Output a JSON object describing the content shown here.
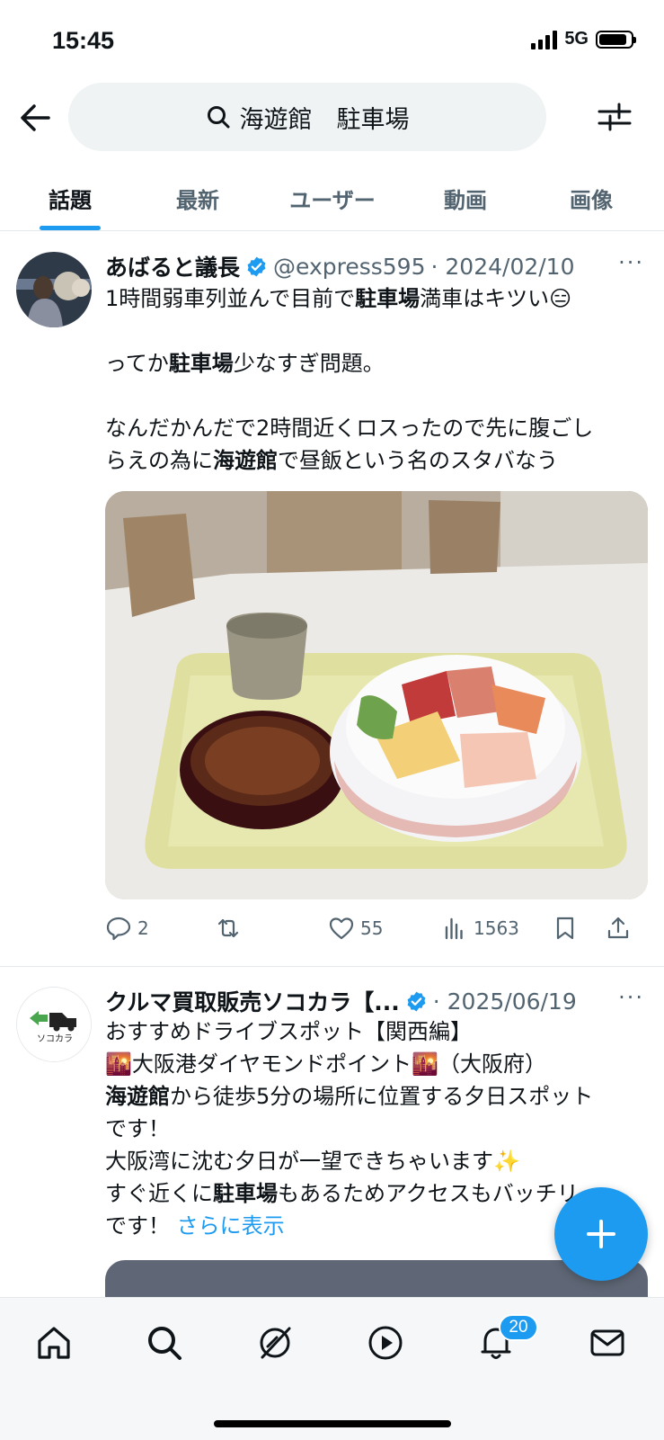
{
  "status": {
    "time": "15:45",
    "network": "5G"
  },
  "search": {
    "query": "海遊館　駐車場"
  },
  "tabs": [
    {
      "label": "話題",
      "active": true
    },
    {
      "label": "最新"
    },
    {
      "label": "ユーザー"
    },
    {
      "label": "動画"
    },
    {
      "label": "画像"
    }
  ],
  "post1": {
    "name": "あばると議長",
    "handle": "@express595",
    "date": "· 2024/02/10",
    "more": "···",
    "line1_pre": "1時間弱車列並んで目前で",
    "line1_bold": "駐車場",
    "line1_post": "満車はキツい😑",
    "line2_pre": "ってか",
    "line2_bold": "駐車場",
    "line2_post": "少なすぎ問題。",
    "line3": "なんだかんだで2時間近くロスったので先に腹ごし",
    "line4_pre": "らえの為に",
    "line4_bold": "海遊館",
    "line4_post": "で昼飯という名のスタバなう",
    "replies": "2",
    "likes": "55",
    "views": "1563"
  },
  "post2": {
    "name": "クルマ買取販売ソコカラ【...",
    "date": "· 2025/06/19",
    "more": "···",
    "logo_text": "ソコカラ",
    "line1": "おすすめドライブスポット【関西編】",
    "line2": "🌇大阪港ダイヤモンドポイント🌇（大阪府）",
    "line3_bold": "海遊館",
    "line3_post": "から徒歩5分の場所に位置する夕日スポット",
    "line4": "です！",
    "line5": "大阪湾に沈む夕日が一望できちゃいます✨",
    "line6_pre": "すぐ近くに",
    "line6_bold": "駐車場",
    "line6_post": "もあるためアクセスもバッチリ",
    "line7": "です！",
    "show_more": "さらに表示"
  },
  "nav": {
    "notifications_badge": "20"
  },
  "colors": {
    "accent": "#1d9bf0",
    "text": "#0f1419",
    "muted": "#536471"
  }
}
